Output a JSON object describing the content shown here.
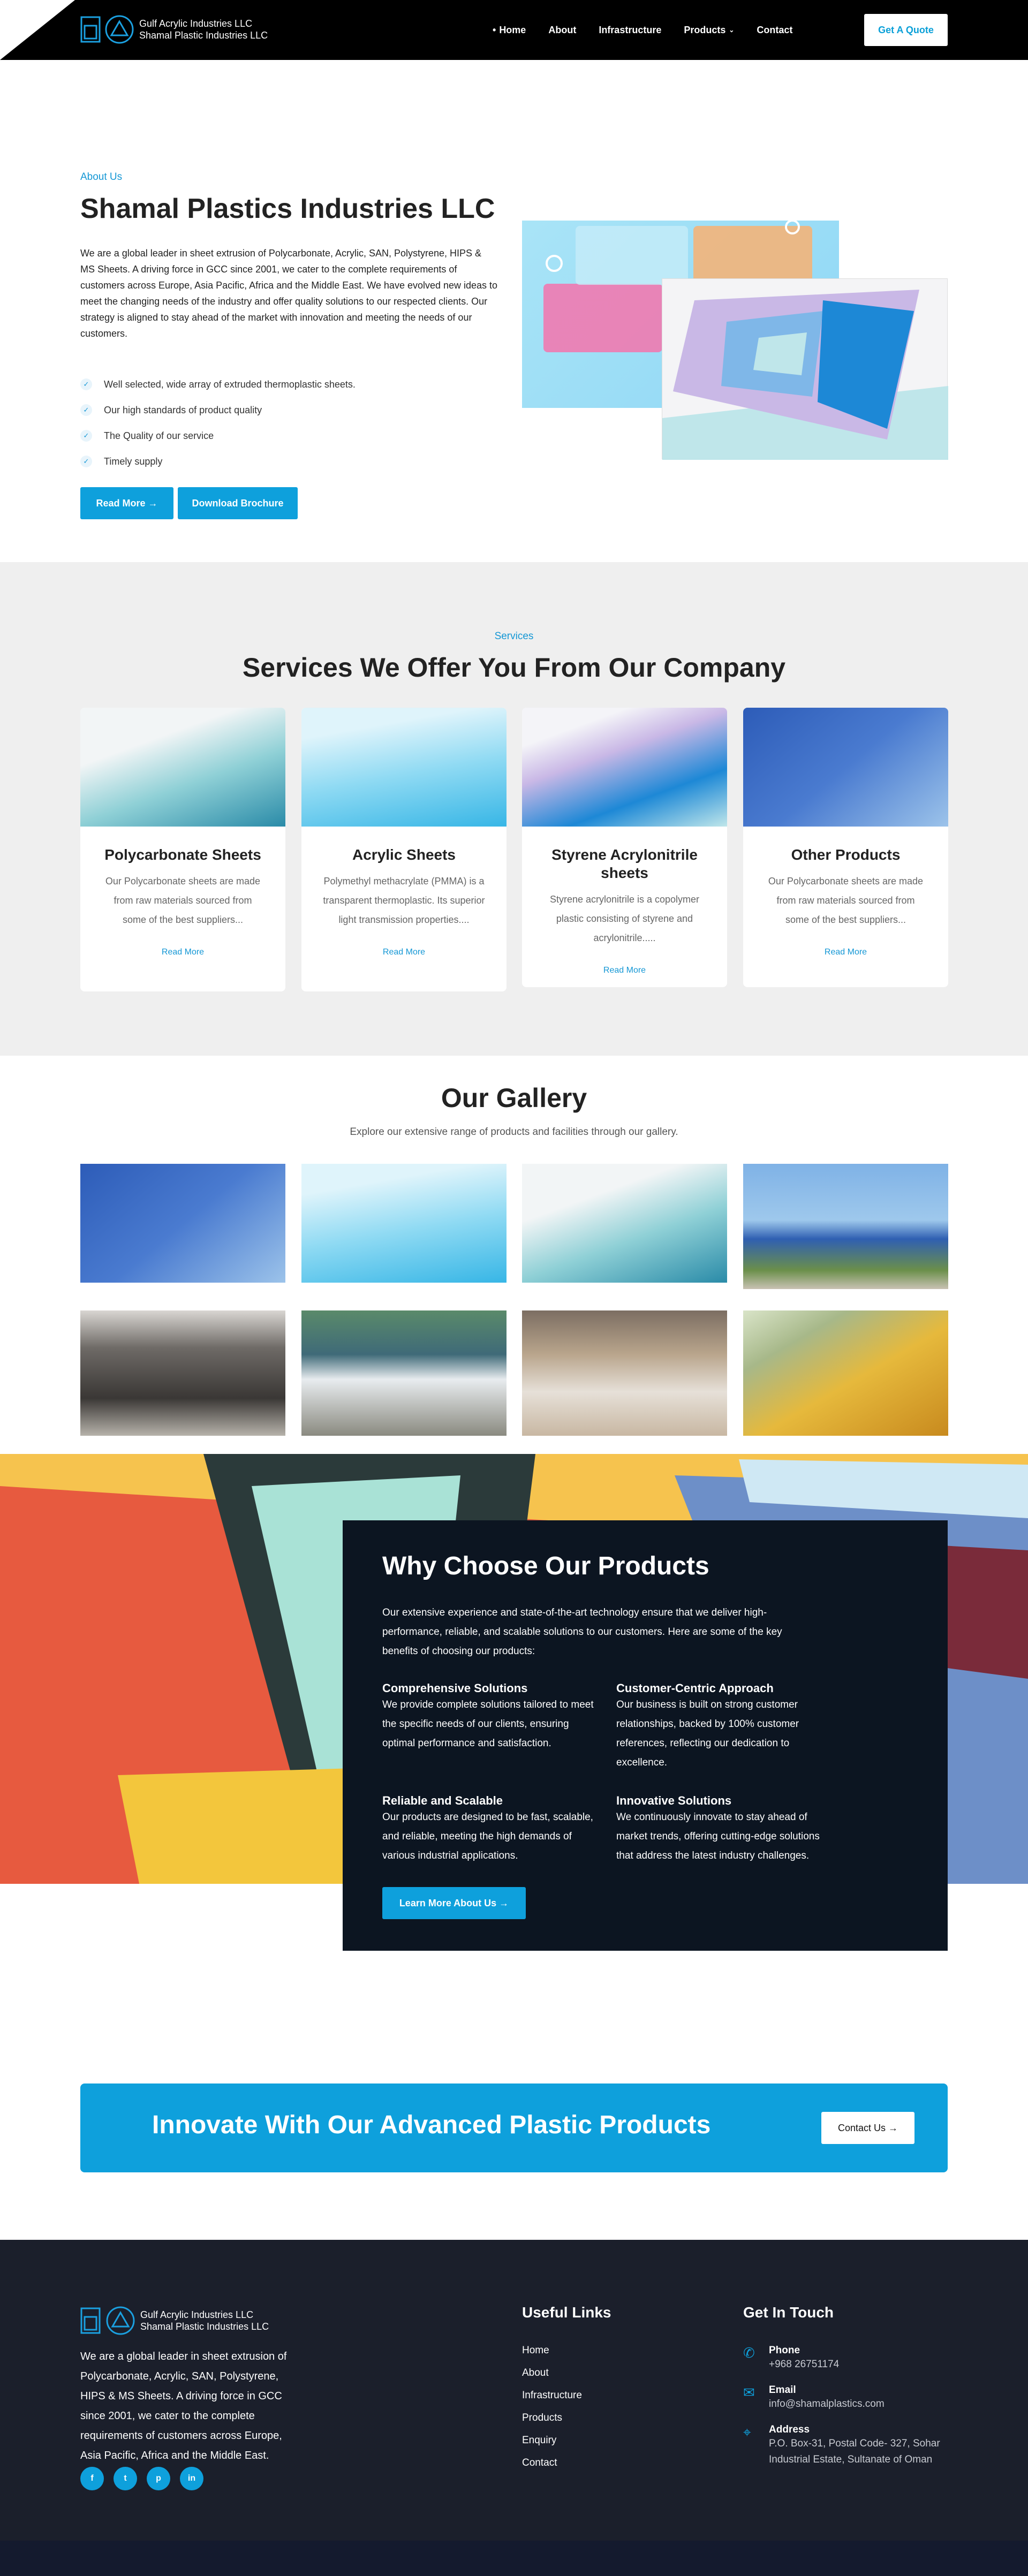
{
  "header": {
    "logo_line1": "Gulf Acrylic Industries LLC",
    "logo_line2": "Shamal Plastic  Industries LLC",
    "nav": [
      {
        "label": "Home",
        "active": true
      },
      {
        "label": "About"
      },
      {
        "label": "Infrastructure"
      },
      {
        "label": "Products",
        "has_dropdown": true
      },
      {
        "label": "Contact"
      }
    ],
    "quote_label": "Get A Quote"
  },
  "about": {
    "kicker": "About Us",
    "title": "Shamal Plastics Industries LLC",
    "paragraph": "We are a global leader in sheet extrusion of Polycarbonate, Acrylic, SAN, Polystyrene, HIPS & MS Sheets. A driving force in GCC since 2001, we cater to the complete requirements of customers across Europe, Asia Pacific, Africa and the Middle East. We have evolved new ideas to meet the changing needs of the industry and offer quality solutions to our respected clients. Our strategy is aligned to stay ahead of the market with innovation and meeting the needs of our customers.",
    "features": [
      "Well selected, wide array of extruded thermoplastic sheets.",
      "Our high standards of product quality",
      "The Quality of our service",
      "Timely supply"
    ],
    "read_more": "Read More",
    "download": "Download Brochure"
  },
  "services": {
    "kicker": "Services",
    "title": "Services We Offer You From Our Company",
    "cards": [
      {
        "title": "Polycarbonate Sheets",
        "text": "Our Polycarbonate sheets are made from raw materials sourced from some of the best suppliers...",
        "link": "Read More"
      },
      {
        "title": "Acrylic Sheets",
        "text": "Polymethyl methacrylate (PMMA) is a transparent thermoplastic. Its superior light transmission properties....",
        "link": "Read More"
      },
      {
        "title": "Styrene Acrylonitrile sheets",
        "text": "Styrene acrylonitrile is a copolymer plastic consisting of styrene and acrylonitrile.....",
        "link": "Read More"
      },
      {
        "title": "Other Products",
        "text": "Our Polycarbonate sheets are made from raw materials sourced from some of the best suppliers...",
        "link": "Read More"
      }
    ]
  },
  "gallery": {
    "title": "Our Gallery",
    "subtitle": "Explore our extensive range of products and facilities through our gallery."
  },
  "why": {
    "title": "Why Choose Our Products",
    "intro": "Our extensive experience and state-of-the-art technology ensure that we deliver high-performance, reliable, and scalable solutions to our customers. Here are some of the key benefits of choosing our products:",
    "items": [
      {
        "title": "Comprehensive Solutions",
        "text": "We provide complete solutions tailored to meet the specific needs of our clients, ensuring optimal performance and satisfaction."
      },
      {
        "title": "Customer-Centric Approach",
        "text": "Our business is built on strong customer relationships, backed by 100% customer references, reflecting our dedication to excellence."
      },
      {
        "title": "Reliable and Scalable",
        "text": "Our products are designed to be fast, scalable, and reliable, meeting the high demands of various industrial applications."
      },
      {
        "title": "Innovative Solutions",
        "text": "We continuously innovate to stay ahead of market trends, offering cutting-edge solutions that address the latest industry challenges."
      }
    ],
    "button": "Learn More About Us"
  },
  "cta": {
    "title": "Innovate With Our Advanced Plastic Products",
    "button": "Contact Us"
  },
  "footer": {
    "logo_line1": "Gulf Acrylic Industries LLC",
    "logo_line2": "Shamal Plastic  Industries LLC",
    "description": "We are a global leader in sheet extrusion of Polycarbonate, Acrylic, SAN, Polystyrene, HIPS & MS Sheets. A driving force in GCC since 2001, we cater to the complete requirements of customers across Europe, Asia Pacific, Africa and the Middle East.",
    "social": [
      "f",
      "t",
      "p",
      "in"
    ],
    "links_title": "Useful Links",
    "links": [
      "Home",
      "About",
      "Infrastructure",
      "Products",
      "Enquiry",
      "Contact"
    ],
    "contact_title": "Get In Touch",
    "phone_label": "Phone",
    "phone": "+968 26751174",
    "email_label": "Email",
    "email": "info@shamalplastics.com",
    "address_label": "Address",
    "address": "P.O. Box-31, Postal Code- 327, Sohar Industrial Estate, Sultanate of Oman"
  },
  "colors": {
    "accent": "#0ea0dc",
    "dark": "#0c1521",
    "footer": "#1b1f2b"
  }
}
